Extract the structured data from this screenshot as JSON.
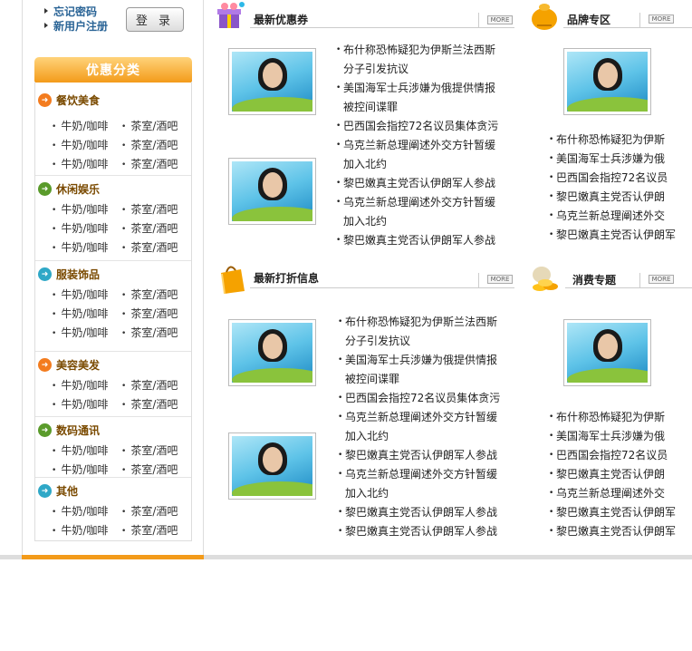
{
  "login": {
    "forgot": "忘记密码",
    "register": "新用户注册",
    "login_button": "登 录"
  },
  "categories_title": "优惠分类",
  "categories": [
    {
      "name": "餐饮美食",
      "icon_color": "#f37c1f",
      "items": [
        "牛奶/咖啡",
        "茶室/酒吧",
        "牛奶/咖啡",
        "茶室/酒吧",
        "牛奶/咖啡",
        "茶室/酒吧"
      ]
    },
    {
      "name": "休闲娱乐",
      "icon_color": "#5a9b2b",
      "items": [
        "牛奶/咖啡",
        "茶室/酒吧",
        "牛奶/咖啡",
        "茶室/酒吧",
        "牛奶/咖啡",
        "茶室/酒吧"
      ]
    },
    {
      "name": "服装饰品",
      "icon_color": "#2fa8c7",
      "items": [
        "牛奶/咖啡",
        "茶室/酒吧",
        "牛奶/咖啡",
        "茶室/酒吧",
        "牛奶/咖啡",
        "茶室/酒吧"
      ]
    },
    {
      "name": "美容美发",
      "icon_color": "#f37c1f",
      "items": [
        "牛奶/咖啡",
        "茶室/酒吧",
        "牛奶/咖啡",
        "茶室/酒吧"
      ]
    },
    {
      "name": "数码通讯",
      "icon_color": "#5a9b2b",
      "items": [
        "牛奶/咖啡",
        "茶室/酒吧",
        "牛奶/咖啡",
        "茶室/酒吧"
      ]
    },
    {
      "name": "其他",
      "icon_color": "#2fa8c7",
      "items": [
        "牛奶/咖啡",
        "茶室/酒吧",
        "牛奶/咖啡",
        "茶室/酒吧"
      ]
    }
  ],
  "more_label": "MORE",
  "sections": {
    "coupons": {
      "title": "最新优惠券",
      "news": [
        [
          "布什称恐怖疑犯为伊斯兰法西斯",
          "分子引发抗议"
        ],
        [
          "美国海军士兵涉嫌为俄提供情报",
          "被控间谍罪"
        ],
        [
          "巴西国会指控72名议员集体贪污"
        ],
        [
          "乌克兰新总理阐述外交方针暂缓",
          "加入北约"
        ],
        [
          "黎巴嫩真主党否认伊朗军人参战"
        ],
        [
          "乌克兰新总理阐述外交方针暂缓",
          "加入北约"
        ],
        [
          "黎巴嫩真主党否认伊朗军人参战"
        ]
      ]
    },
    "brands": {
      "title": "品牌专区",
      "news": [
        "布什称恐怖疑犯为伊斯",
        "美国海军士兵涉嫌为俄",
        "巴西国会指控72名议员",
        "黎巴嫩真主党否认伊朗",
        "乌克兰新总理阐述外交",
        "黎巴嫩真主党否认伊朗军"
      ]
    },
    "discounts": {
      "title": "最新打折信息",
      "news": [
        [
          "布什称恐怖疑犯为伊斯兰法西斯",
          "分子引发抗议"
        ],
        [
          "美国海军士兵涉嫌为俄提供情报",
          "被控间谍罪"
        ],
        [
          "巴西国会指控72名议员集体贪污"
        ],
        [
          "乌克兰新总理阐述外交方针暂缓",
          "加入北约"
        ],
        [
          "黎巴嫩真主党否认伊朗军人参战"
        ],
        [
          "乌克兰新总理阐述外交方针暂缓",
          "加入北约"
        ],
        [
          "黎巴嫩真主党否认伊朗军人参战"
        ],
        [
          "黎巴嫩真主党否认伊朗军人参战"
        ]
      ]
    },
    "topics": {
      "title": "消费专题",
      "news": [
        "布什称恐怖疑犯为伊斯",
        "美国海军士兵涉嫌为俄",
        "巴西国会指控72名议员",
        "黎巴嫩真主党否认伊朗",
        "乌克兰新总理阐述外交",
        "黎巴嫩真主党否认伊朗军",
        "黎巴嫩真主党否认伊朗军"
      ]
    }
  }
}
